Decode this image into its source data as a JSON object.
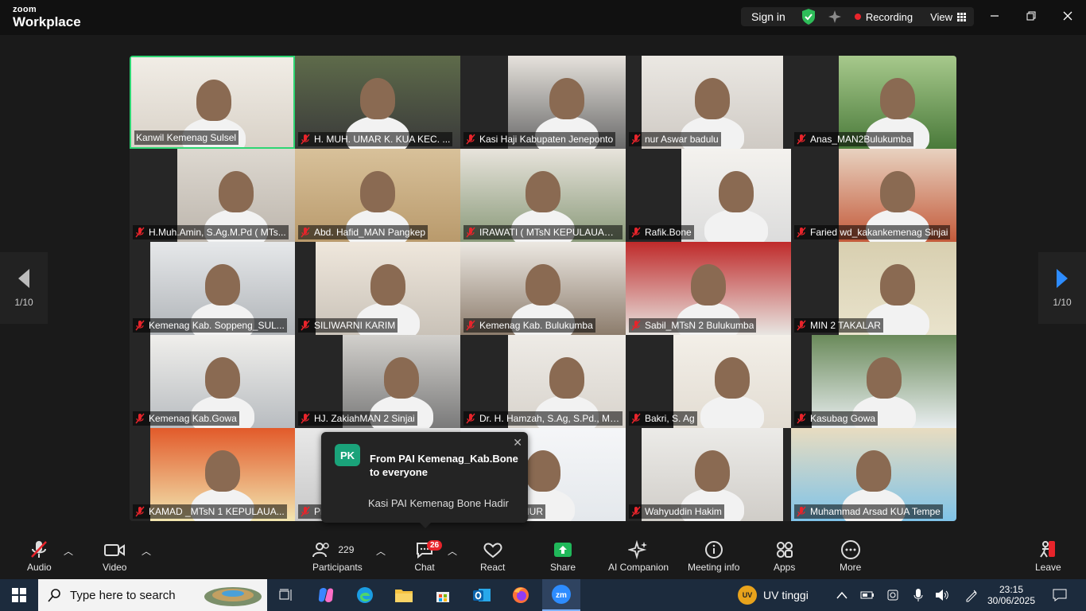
{
  "app": {
    "brand_top": "zoom",
    "brand_bottom": "Workplace"
  },
  "titlebar": {
    "sign_in": "Sign in",
    "recording": "Recording",
    "view": "View"
  },
  "tiles": [
    {
      "name": "Kanwil Kemenag Sulsel",
      "muted": false,
      "active": true
    },
    {
      "name": "H. MUH. UMAR K. KUA KEC. ...",
      "muted": true
    },
    {
      "name": "Kasi Haji Kabupaten Jeneponto",
      "muted": true
    },
    {
      "name": "nur Aswar badulu",
      "muted": true
    },
    {
      "name": "Anas_MAN2Bulukumba",
      "muted": true
    },
    {
      "name": "H.Muh.Amin, S.Ag.M.Pd ( MTs...",
      "muted": true
    },
    {
      "name": "Abd. Hafid_MAN Pangkep",
      "muted": true
    },
    {
      "name": "IRAWATI ( MTsN KEPULAUAN ...",
      "muted": true
    },
    {
      "name": "Rafik.Bone",
      "muted": true
    },
    {
      "name": "Faried wd_kakankemenag Sinjai",
      "muted": true
    },
    {
      "name": "Kemenag Kab. Soppeng_SUL...",
      "muted": true
    },
    {
      "name": "SILIWARNI KARIM",
      "muted": true
    },
    {
      "name": "Kemenag Kab. Bulukumba",
      "muted": true
    },
    {
      "name": "Sabil_MTsN 2 Bulukumba",
      "muted": true
    },
    {
      "name": "MIN 2 TAKALAR",
      "muted": true
    },
    {
      "name": "Kemenag Kab.Gowa",
      "muted": true
    },
    {
      "name": "HJ. ZakiahMAN 2 Sinjai",
      "muted": true
    },
    {
      "name": "Dr. H. Hamzah, S.Ag, S.Pd., M....",
      "muted": true
    },
    {
      "name": "Bakri, S. Ag",
      "muted": true
    },
    {
      "name": "Kasubag Gowa",
      "muted": true
    },
    {
      "name": "KAMAD _MTsN 1 KEPULAUA...",
      "muted": true
    },
    {
      "name": "Pr...",
      "muted": true
    },
    {
      "name": "LUWU_TIMUR",
      "muted": true
    },
    {
      "name": "Wahyuddin Hakim",
      "muted": true
    },
    {
      "name": "Muhammad Arsad KUA Tempe",
      "muted": true
    }
  ],
  "pagination": {
    "left": "1/10",
    "right": "1/10"
  },
  "chat_popup": {
    "initials": "PK",
    "from": "From PAI Kemenag_Kab.Bone to everyone",
    "message": "Kasi PAI Kemenag Bone Hadir"
  },
  "toolbar": {
    "audio": "Audio",
    "video": "Video",
    "participants": "Participants",
    "participants_count": "229",
    "chat": "Chat",
    "chat_badge": "26",
    "react": "React",
    "share": "Share",
    "ai_companion": "AI Companion",
    "meeting_info": "Meeting info",
    "apps": "Apps",
    "more": "More",
    "leave": "Leave"
  },
  "taskbar": {
    "search_placeholder": "Type here to search",
    "weather_badge": "UV",
    "weather": "UV tinggi",
    "time": "23:15",
    "date": "30/06/2025"
  },
  "colors": {
    "active_border": "#2ed573",
    "mute_red": "#e8242b",
    "share_green": "#20b85a",
    "accent_blue": "#2d8cff"
  }
}
